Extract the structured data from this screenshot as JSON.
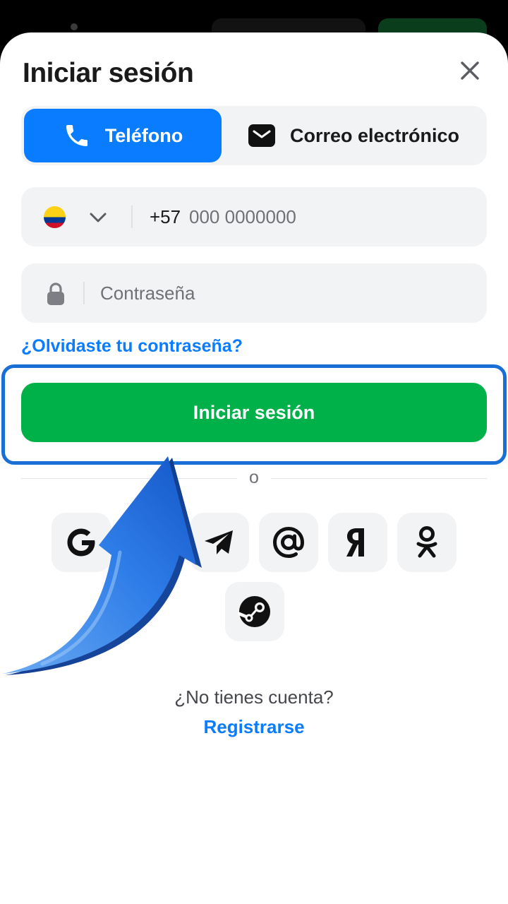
{
  "header": {
    "title": "Iniciar sesión"
  },
  "tabs": [
    {
      "label": "Teléfono",
      "icon": "phone-icon",
      "active": true
    },
    {
      "label": "Correo electrónico",
      "icon": "mail-icon",
      "active": false
    }
  ],
  "phone_field": {
    "country_code": "+57",
    "placeholder": "000 0000000",
    "flag": "colombia-flag-icon"
  },
  "password_field": {
    "placeholder": "Contraseña"
  },
  "forgot_link": "¿Olvidaste tu contraseña?",
  "login_button": "Iniciar sesión",
  "divider_text": "o",
  "social_login": [
    "google-icon",
    "telegram-icon",
    "mail-ru-icon",
    "yandex-icon",
    "odnoklassniki-icon",
    "steam-icon"
  ],
  "footer": {
    "no_account_text": "¿No tienes cuenta?",
    "register_link": "Registrarse"
  },
  "colors": {
    "accent_blue": "#0a7cff",
    "login_green": "#00b14a",
    "highlight_border": "#1a6fd6",
    "field_bg": "#f2f3f5"
  }
}
